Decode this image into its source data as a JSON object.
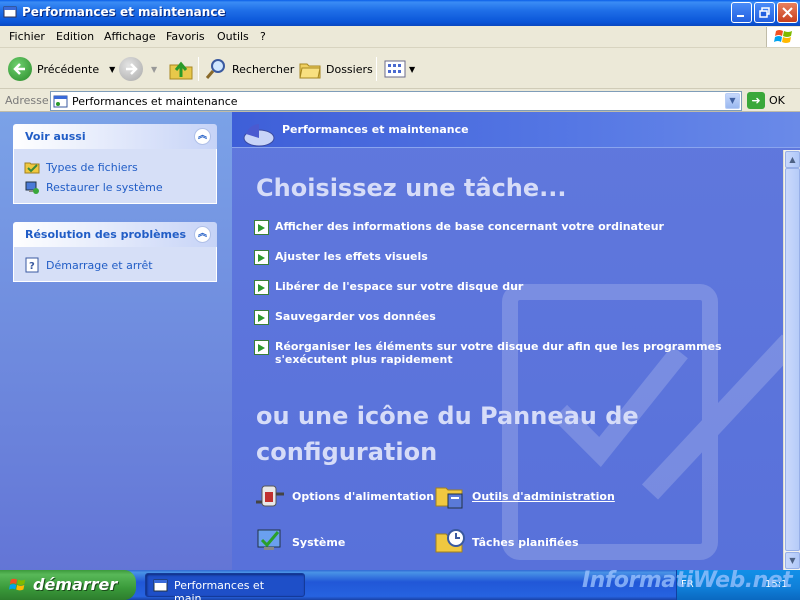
{
  "window": {
    "title": "Performances et maintenance",
    "minimize_icon": "minimize-icon",
    "maximize_icon": "restore-icon",
    "close_icon": "close-icon"
  },
  "menu": {
    "items": [
      "Fichier",
      "Edition",
      "Affichage",
      "Favoris",
      "Outils",
      "?"
    ]
  },
  "toolbar": {
    "back_label": "Précédente",
    "search_label": "Rechercher",
    "folders_label": "Dossiers"
  },
  "address": {
    "label": "Adresse",
    "value": "Performances et maintenance",
    "go_label": "OK"
  },
  "sidebar": {
    "see_also": {
      "title": "Voir aussi",
      "links": [
        "Types de fichiers",
        "Restaurer le système"
      ]
    },
    "troubleshoot": {
      "title": "Résolution des problèmes",
      "links": [
        "Démarrage et arrêt"
      ]
    }
  },
  "main": {
    "header_title": "Performances et maintenance",
    "pick_task": "Choisissez une tâche...",
    "tasks": [
      "Afficher des informations de base concernant votre ordinateur",
      "Ajuster les effets visuels",
      "Libérer de l'espace sur votre disque dur",
      "Sauvegarder vos données",
      "Réorganiser les éléments sur votre disque dur afin que les programmes s'exécutent plus rapidement"
    ],
    "or_icon": "ou une icône du Panneau de configuration",
    "icons": [
      {
        "label": "Options d'alimentation"
      },
      {
        "label": "Outils d'administration"
      },
      {
        "label": "Système"
      },
      {
        "label": "Tâches planifiées"
      }
    ]
  },
  "taskbar": {
    "start_label": "démarrer",
    "window_button": "Performances et main...",
    "lang": "FR",
    "clock": "15:1",
    "watermark": "InformatiWeb.net"
  },
  "colors": {
    "accent": "#215dc6",
    "task_pane": "#6375d6",
    "start_green": "#3a9a3a"
  }
}
